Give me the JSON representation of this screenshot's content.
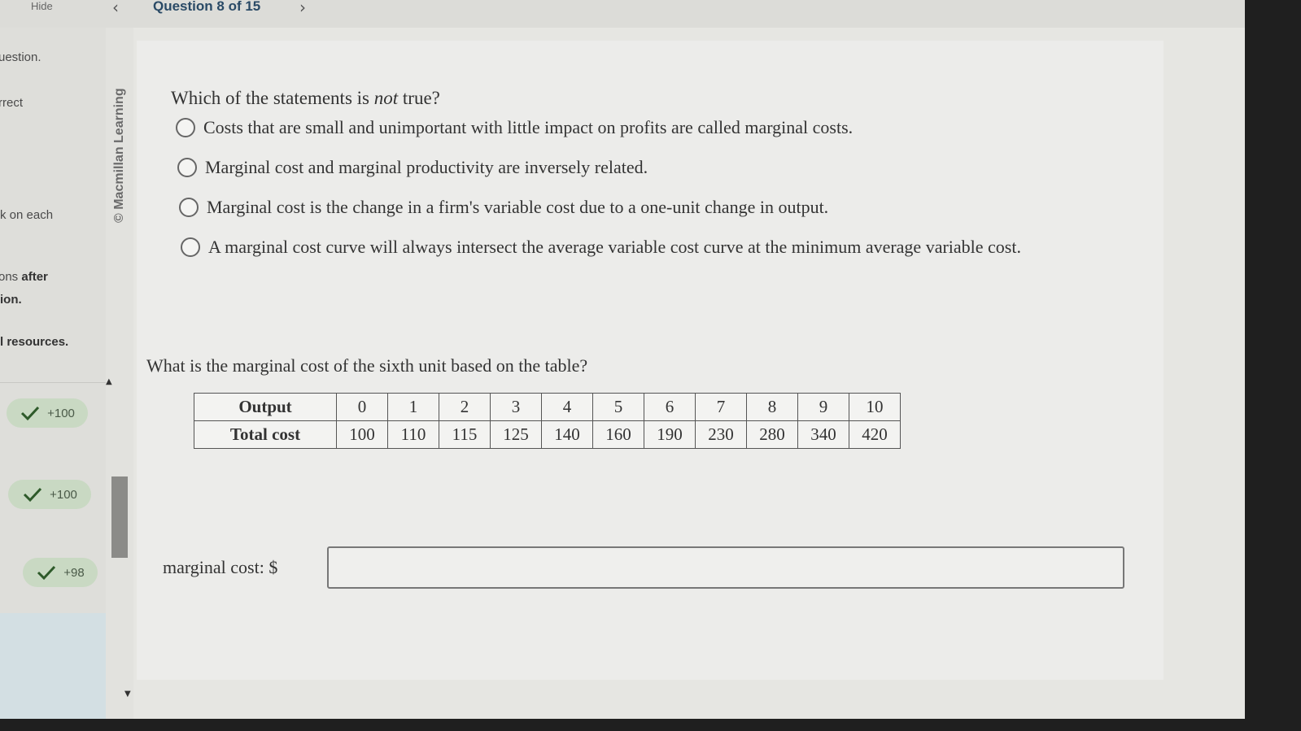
{
  "topbar": {
    "hide_label": "Hide",
    "prev_icon": "chevron-left-icon",
    "question_counter": "Question 8 of 15",
    "next_icon": "chevron-right-icon"
  },
  "sidebar": {
    "notes": [
      "uestion.",
      "rrect",
      "k on each",
      "ons",
      "after",
      "ion.",
      "l resources."
    ],
    "scores": [
      "+100",
      "+100",
      "+98"
    ],
    "check_icon": "checkmark-icon"
  },
  "brand_text": "© Macmillan Learning",
  "question1": {
    "prompt_before": "Which of the statements is ",
    "prompt_emphasis": "not",
    "prompt_after": " true?",
    "options": [
      "Costs that are small and unimportant with little impact on profits are called marginal costs.",
      "Marginal cost and marginal productivity are inversely related.",
      "Marginal cost is the change in a firm's variable cost due to a one-unit change in output.",
      "A marginal cost curve will always intersect the average variable cost curve at the minimum average variable cost."
    ]
  },
  "question2": {
    "prompt": "What is the marginal cost of the sixth unit based on the table?",
    "table": {
      "row_headers": [
        "Output",
        "Total cost"
      ],
      "output": [
        "0",
        "1",
        "2",
        "3",
        "4",
        "5",
        "6",
        "7",
        "8",
        "9",
        "10"
      ],
      "total_cost": [
        "100",
        "110",
        "115",
        "125",
        "140",
        "160",
        "190",
        "230",
        "280",
        "340",
        "420"
      ]
    },
    "answer_label": "marginal cost: $",
    "answer_value": ""
  },
  "colors": {
    "score_pill": "#c9d9c3",
    "check": "#2e5a2a",
    "title": "#2a4a66"
  }
}
